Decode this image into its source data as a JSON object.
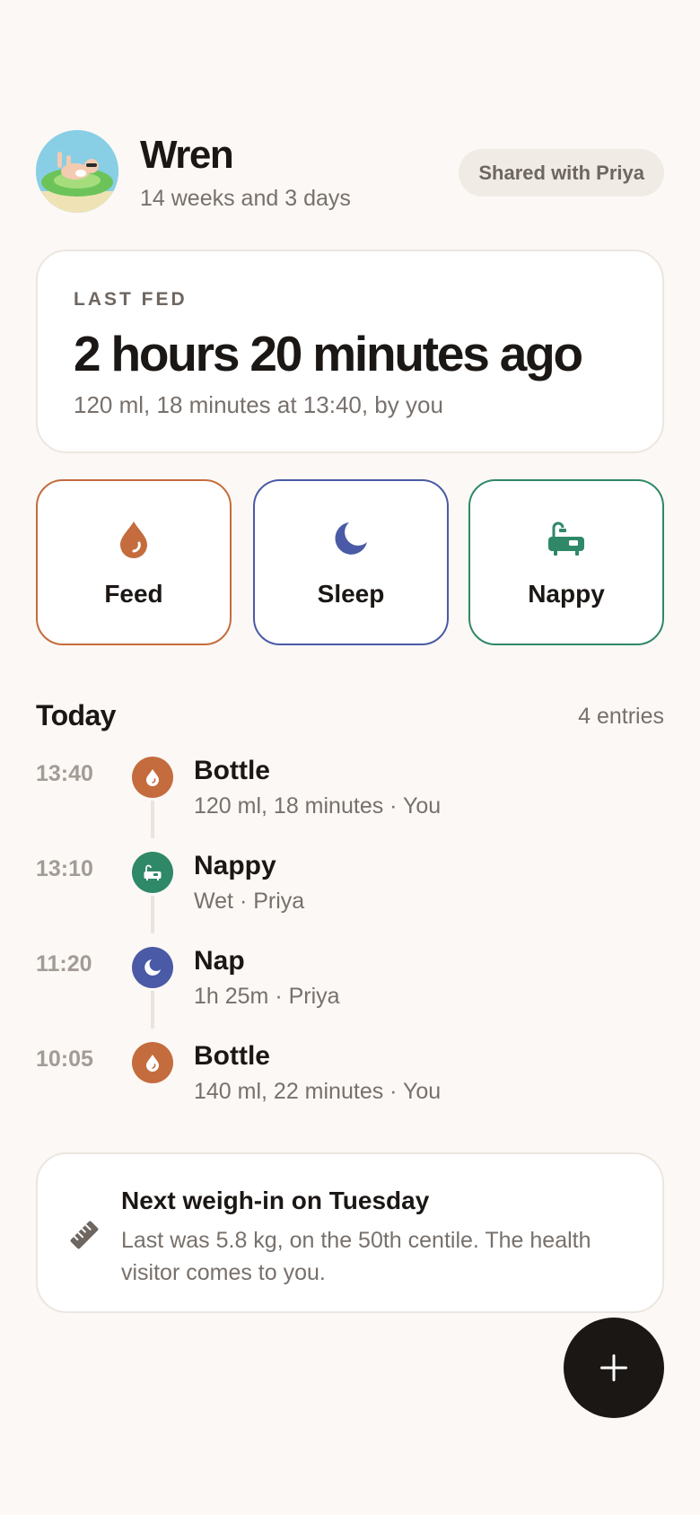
{
  "profile": {
    "name": "Wren",
    "age": "14 weeks and 3 days",
    "shared_label": "Shared with Priya"
  },
  "last_fed": {
    "eyebrow": "LAST FED",
    "time_ago": "2 hours 20 minutes ago",
    "detail": "120 ml, 18 minutes at 13:40, by you"
  },
  "actions": [
    {
      "label": "Feed",
      "icon": "drop-icon",
      "color": "#c46c3d"
    },
    {
      "label": "Sleep",
      "icon": "moon-icon",
      "color": "#4a5aa6"
    },
    {
      "label": "Nappy",
      "icon": "bath-icon",
      "color": "#2f8868"
    }
  ],
  "today": {
    "title": "Today",
    "count": "4 entries",
    "entries": [
      {
        "time": "13:40",
        "title": "Bottle",
        "detail": "120 ml, 18 minutes · You",
        "type": "feed",
        "icon": "drop-icon"
      },
      {
        "time": "13:10",
        "title": "Nappy",
        "detail": "Wet · Priya",
        "type": "nappy",
        "icon": "bath-icon"
      },
      {
        "time": "11:20",
        "title": "Nap",
        "detail": "1h 25m · Priya",
        "type": "sleep",
        "icon": "moon-icon"
      },
      {
        "time": "10:05",
        "title": "Bottle",
        "detail": "140 ml, 22 minutes · You",
        "type": "feed",
        "icon": "drop-icon"
      }
    ]
  },
  "weigh_in": {
    "title": "Next weigh-in on Tuesday",
    "body": "Last was 5.8 kg, on the 50th centile. The health visitor comes to you.",
    "icon": "ruler-icon"
  },
  "fab": {
    "icon": "plus-icon"
  },
  "colors": {
    "background": "#fcf8f5",
    "feed": "#c46c3d",
    "sleep": "#4a5aa6",
    "nappy": "#2f8868",
    "text": "#1b1715",
    "muted": "#77706b"
  }
}
